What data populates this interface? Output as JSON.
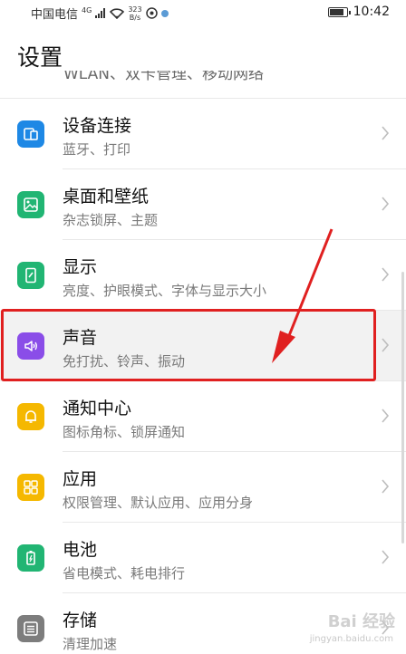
{
  "status_bar": {
    "carrier": "中国电信",
    "network": "4G",
    "speed_value": "323",
    "speed_unit": "B/s",
    "time": "10:42"
  },
  "page": {
    "title": "设置",
    "clipped_row_text": "WLAN、双卡管理、移动网络"
  },
  "items": [
    {
      "title": "设备连接",
      "subtitle": "蓝牙、打印",
      "icon": "device-connect-icon",
      "icon_color": "#1e88e5"
    },
    {
      "title": "桌面和壁纸",
      "subtitle": "杂志锁屏、主题",
      "icon": "wallpaper-icon",
      "icon_color": "#21b573"
    },
    {
      "title": "显示",
      "subtitle": "亮度、护眼模式、字体与显示大小",
      "icon": "display-icon",
      "icon_color": "#21b573"
    },
    {
      "title": "声音",
      "subtitle": "免打扰、铃声、振动",
      "icon": "sound-icon",
      "icon_color": "#8a4de8"
    },
    {
      "title": "通知中心",
      "subtitle": "图标角标、锁屏通知",
      "icon": "notification-icon",
      "icon_color": "#f5b800"
    },
    {
      "title": "应用",
      "subtitle": "权限管理、默认应用、应用分身",
      "icon": "apps-icon",
      "icon_color": "#f5b800"
    },
    {
      "title": "电池",
      "subtitle": "省电模式、耗电排行",
      "icon": "battery-icon",
      "icon_color": "#21b573"
    },
    {
      "title": "存储",
      "subtitle": "清理加速",
      "icon": "storage-icon",
      "icon_color": "#7d7d7d"
    }
  ],
  "annotation": {
    "highlight_color": "#e02020"
  },
  "watermark": {
    "main": "Bai 经验",
    "sub": "jingyan.baidu.com"
  }
}
